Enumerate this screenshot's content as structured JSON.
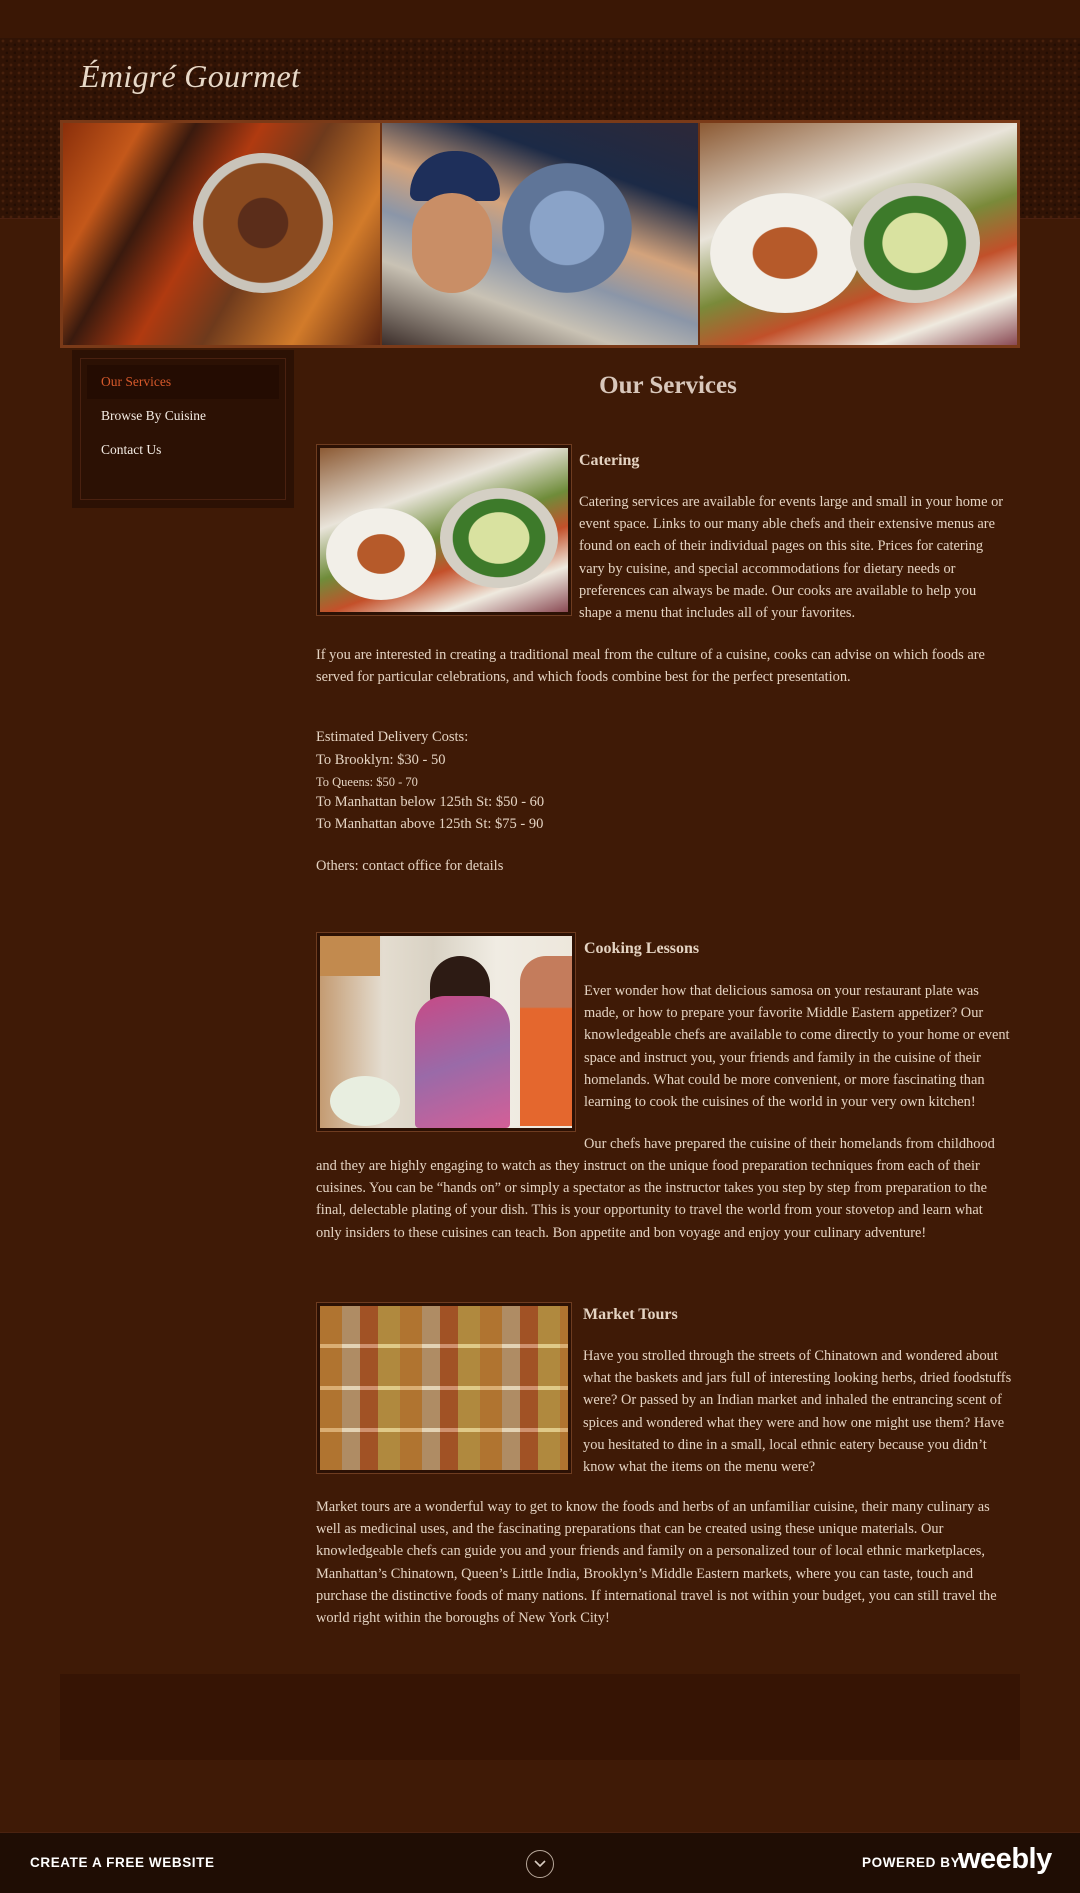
{
  "site": {
    "title": "Émigré Gourmet"
  },
  "nav": {
    "items": [
      {
        "label": "Our Services",
        "active": true
      },
      {
        "label": "Browse By Cuisine",
        "active": false
      },
      {
        "label": "Contact Us",
        "active": false
      }
    ]
  },
  "page": {
    "title": "Our Services"
  },
  "catering": {
    "title": "Catering",
    "p1_lines": [
      "Catering services are available for events large and small in your home or",
      "event space. Links to our many able chefs and their extensive menus are",
      "found on each of their individual pages on this site. Prices for catering",
      "vary by cuisine, and special accommodations for dietary needs or",
      "preferences can always be made. Our cooks are available to help you",
      "shape a menu that includes all of your favorites."
    ],
    "p2_lines": [
      "If you are interested in creating a traditional meal from the culture of a cuisine, cooks can advise on which foods are",
      "served for particular celebrations, and which foods combine best for the perfect presentation."
    ]
  },
  "delivery": {
    "heading": "Estimated Delivery Costs:",
    "brooklyn": "To Brooklyn: $30 - 50",
    "queens": "To Queens: $50 - 70",
    "manhattan_below": "To Manhattan below 125th St: $50 - 60",
    "manhattan_above": "To Manhattan above 125th St: $75 - 90",
    "others": "Others: contact office for details"
  },
  "cooking": {
    "title": "Cooking Lessons",
    "p1_lines": [
      "Ever wonder how that delicious samosa on your restaurant plate was",
      "made, or how to prepare your favorite Middle Eastern appetizer? Our",
      "knowledgeable chefs are available to come directly to your home or event",
      "space and instruct you, your friends and family in the cuisine of their",
      "homelands. What could be more convenient, or more fascinating than",
      "learning to cook the cuisines of the world in your very own kitchen!"
    ],
    "p2_first": "Our chefs have prepared the cuisine of their homelands from childhood",
    "p2_lines": [
      "and they are highly engaging to watch as they instruct on the unique food preparation techniques from each of their",
      "cuisines. You can be “hands on” or simply a spectator as the instructor takes you step by step from preparation to the",
      "final, delectable plating of your dish. This is your opportunity to travel the world from your stovetop and learn what",
      "only insiders to these cuisines can teach. Bon appetite and bon voyage and enjoy your culinary adventure!"
    ]
  },
  "market": {
    "title": "Market Tours",
    "p1_lines": [
      "Have you strolled through the streets of Chinatown and wondered about",
      "what the baskets and jars full of interesting looking herbs, dried foodstuffs",
      "were? Or passed by an Indian market and inhaled the entrancing scent of",
      "spices and wondered what they were and how one might use them? Have",
      "you hesitated to dine in a small, local ethnic eatery because you didn’t",
      "know what the items on the menu were?"
    ],
    "p2_lines": [
      "Market tours are a wonderful way to get to know the foods and herbs of an unfamiliar cuisine, their many culinary as",
      "well as medicinal uses, and the fascinating preparations that can be created using these unique materials. Our",
      "knowledgeable chefs can guide you and your friends and family on a personalized tour of local ethnic marketplaces,",
      "Manhattan’s Chinatown, Queen’s Little India, Brooklyn’s Middle Eastern markets, where you can taste, touch and",
      "purchase the distinctive foods of many nations. If international travel is not within your budget, you can still travel the",
      "world right within the boroughs of New York City!"
    ]
  },
  "weebly_bar": {
    "create_label": "CREATE A FREE WEBSITE",
    "powered_label": "POWERED BY",
    "brand": "weebly"
  },
  "colors": {
    "background": "#3f1a06",
    "nav_active": "#d6592b",
    "text": "#e4d3c2"
  }
}
